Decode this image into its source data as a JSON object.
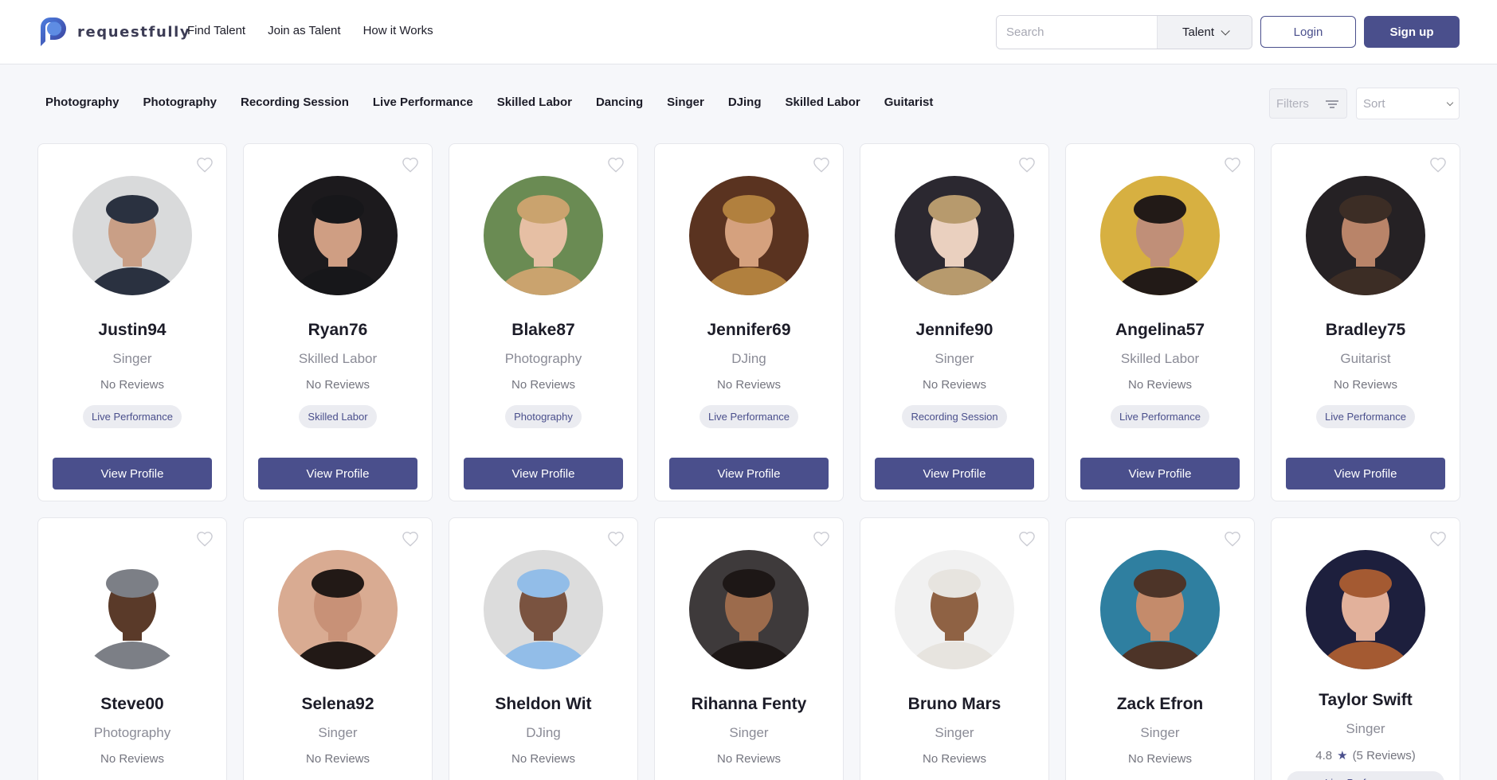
{
  "header": {
    "logo_text": "requestfully",
    "nav": [
      "Find Talent",
      "Join as Talent",
      "How it Works"
    ],
    "search_placeholder": "Search",
    "search_category": "Talent",
    "login_label": "Login",
    "signup_label": "Sign up"
  },
  "categories": [
    "Photography",
    "Photography",
    "Recording Session",
    "Live Performance",
    "Skilled Labor",
    "Dancing",
    "Singer",
    "DJing",
    "Skilled Labor",
    "Guitarist"
  ],
  "filters_label": "Filters",
  "sort_placeholder": "Sort",
  "view_profile_label": "View Profile",
  "colors": {
    "accent": "#4a4f8c",
    "page_bg": "#f6f7fa",
    "tag_bg": "#ebecf1"
  },
  "talents": [
    {
      "name": "Justin94",
      "role": "Singer",
      "reviews": "No Reviews",
      "tag": "Live Performance",
      "avatar_colors": [
        "#d9dadb",
        "#2a3140",
        "#c99f86"
      ]
    },
    {
      "name": "Ryan76",
      "role": "Skilled Labor",
      "reviews": "No Reviews",
      "tag": "Skilled Labor",
      "avatar_colors": [
        "#1c1a1d",
        "#17171a",
        "#cf9e83"
      ]
    },
    {
      "name": "Blake87",
      "role": "Photography",
      "reviews": "No Reviews",
      "tag": "Photography",
      "avatar_colors": [
        "#6a8b53",
        "#caa36e",
        "#e6bfa4"
      ]
    },
    {
      "name": "Jennifer69",
      "role": "DJing",
      "reviews": "No Reviews",
      "tag": "Live Performance",
      "avatar_colors": [
        "#5a3320",
        "#b1803e",
        "#d5a17e"
      ]
    },
    {
      "name": "Jennife90",
      "role": "Singer",
      "reviews": "No Reviews",
      "tag": "Recording Session",
      "avatar_colors": [
        "#2b2830",
        "#b79a6d",
        "#ead0bf"
      ]
    },
    {
      "name": "Angelina57",
      "role": "Skilled Labor",
      "reviews": "No Reviews",
      "tag": "Live Performance",
      "avatar_colors": [
        "#d7b041",
        "#221a17",
        "#c08f78"
      ]
    },
    {
      "name": "Bradley75",
      "role": "Guitarist",
      "reviews": "No Reviews",
      "tag": "Live Performance",
      "avatar_colors": [
        "#252124",
        "#3c2d25",
        "#b98469"
      ]
    },
    {
      "name": "Steve00",
      "role": "Photography",
      "reviews": "No Reviews",
      "tag": "",
      "avatar_colors": [
        "#ffffff",
        "#7c7f86",
        "#5a3a29"
      ]
    },
    {
      "name": "Selena92",
      "role": "Singer",
      "reviews": "No Reviews",
      "tag": "",
      "avatar_colors": [
        "#d9ab92",
        "#221916",
        "#c89177"
      ]
    },
    {
      "name": "Sheldon Wit",
      "role": "DJing",
      "reviews": "No Reviews",
      "tag": "",
      "avatar_colors": [
        "#dcdcdc",
        "#92bde8",
        "#7a5340"
      ]
    },
    {
      "name": "Rihanna Fenty",
      "role": "Singer",
      "reviews": "No Reviews",
      "tag": "",
      "avatar_colors": [
        "#3e3a3b",
        "#1d1716",
        "#9c6b4c"
      ]
    },
    {
      "name": "Bruno Mars",
      "role": "Singer",
      "reviews": "No Reviews",
      "tag": "",
      "avatar_colors": [
        "#f1f1f1",
        "#e7e4df",
        "#8f6244"
      ]
    },
    {
      "name": "Zack Efron",
      "role": "Singer",
      "reviews": "No Reviews",
      "tag": "",
      "avatar_colors": [
        "#2f7fa0",
        "#4d3428",
        "#c48b6b"
      ]
    },
    {
      "name": "Taylor Swift",
      "role": "Singer",
      "rating": "4.8",
      "rating_star": "★",
      "reviews": "(5 Reviews)",
      "tag": "Live Performance",
      "avatar_colors": [
        "#1d1f3d",
        "#a45a32",
        "#e2b19b"
      ]
    }
  ]
}
